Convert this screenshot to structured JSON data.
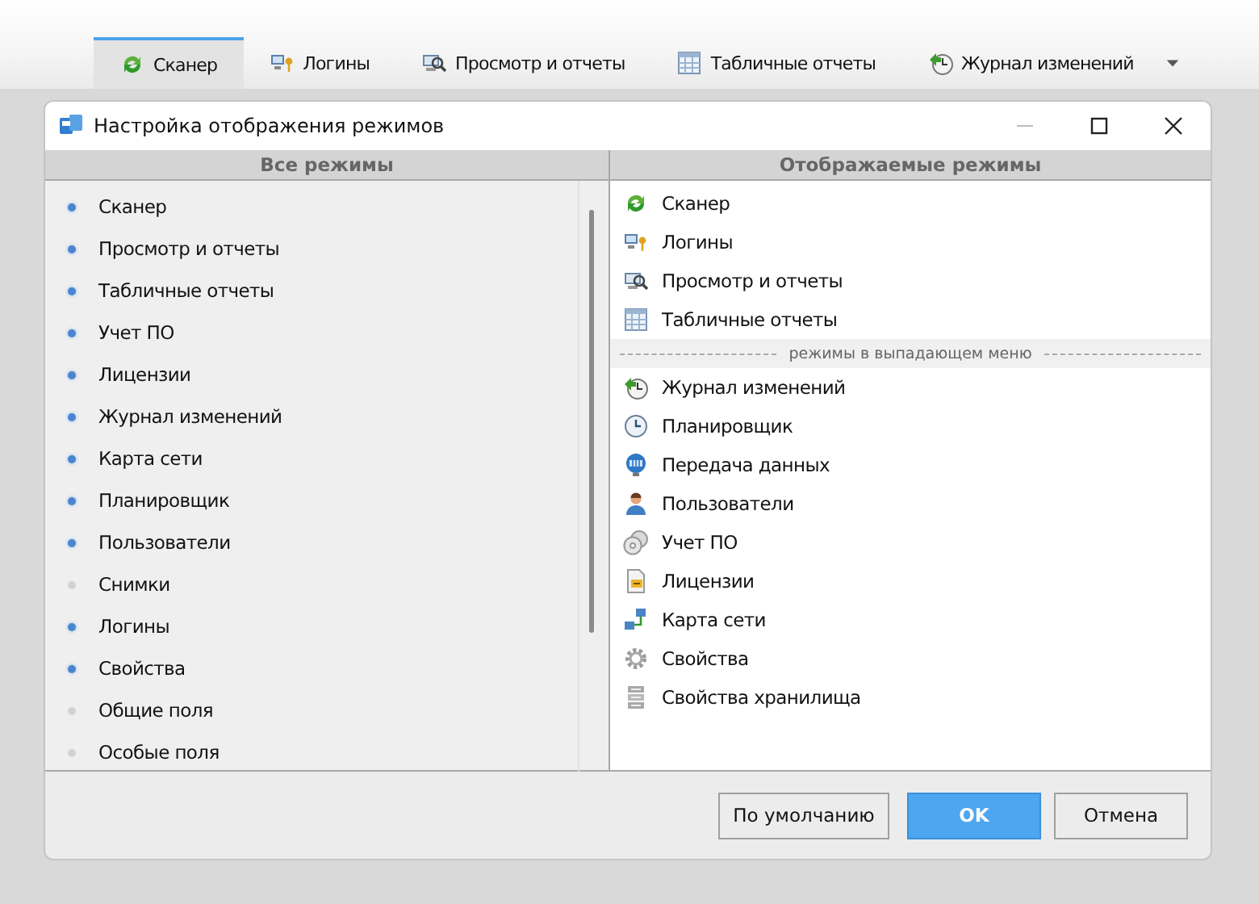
{
  "tabs": [
    {
      "label": "Сканер",
      "selected": true
    },
    {
      "label": "Логины",
      "selected": false
    },
    {
      "label": "Просмотр и отчеты",
      "selected": false
    },
    {
      "label": "Табличные отчеты",
      "selected": false
    },
    {
      "label": "Журнал изменений",
      "selected": false
    }
  ],
  "dialog": {
    "title": "Настройка отображения режимов",
    "all_modes": {
      "header": "Все режимы",
      "items": [
        {
          "label": "Сканер",
          "shown": true
        },
        {
          "label": "Просмотр и отчеты",
          "shown": true
        },
        {
          "label": "Табличные отчеты",
          "shown": true
        },
        {
          "label": "Учет ПО",
          "shown": true
        },
        {
          "label": "Лицензии",
          "shown": true
        },
        {
          "label": "Журнал изменений",
          "shown": true
        },
        {
          "label": "Карта сети",
          "shown": true
        },
        {
          "label": "Планировщик",
          "shown": true
        },
        {
          "label": "Пользователи",
          "shown": true
        },
        {
          "label": "Снимки",
          "shown": false
        },
        {
          "label": "Логины",
          "shown": true
        },
        {
          "label": "Свойства",
          "shown": true
        },
        {
          "label": "Общие поля",
          "shown": false
        },
        {
          "label": "Особые поля",
          "shown": false
        }
      ]
    },
    "shown_modes": {
      "header": "Отображаемые режимы",
      "items": [
        "Сканер",
        "Логины",
        "Просмотр и отчеты",
        "Табличные отчеты"
      ],
      "separator": "режимы в выпадающем меню",
      "menu_items": [
        "Журнал изменений",
        "Планировщик",
        "Передача данных",
        "Пользователи",
        "Учет ПО",
        "Лицензии",
        "Карта сети",
        "Свойства",
        "Свойства хранилища"
      ]
    },
    "buttons": [
      {
        "label": "По умолчанию",
        "default": false
      },
      {
        "label": "OK",
        "default": true
      },
      {
        "label": "Отмена",
        "default": false
      }
    ]
  }
}
